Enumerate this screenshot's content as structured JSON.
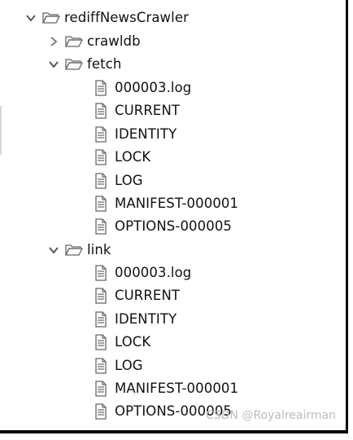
{
  "tree": {
    "root": {
      "label": "rediffNewsCrawler",
      "expanded": true,
      "icon": "folder-open-icon"
    },
    "crawldb": {
      "label": "crawldb",
      "expanded": false,
      "icon": "folder-open-icon"
    },
    "fetch": {
      "label": "fetch",
      "expanded": true,
      "icon": "folder-open-icon",
      "files": [
        "000003.log",
        "CURRENT",
        "IDENTITY",
        "LOCK",
        "LOG",
        "MANIFEST-000001",
        "OPTIONS-000005"
      ]
    },
    "link": {
      "label": "link",
      "expanded": true,
      "icon": "folder-open-icon",
      "files": [
        "000003.log",
        "CURRENT",
        "IDENTITY",
        "LOCK",
        "LOG",
        "MANIFEST-000001",
        "OPTIONS-000005"
      ]
    }
  },
  "watermark": "CSDN @Royalreairman",
  "colors": {
    "text": "#111111",
    "icon_stroke": "#666666",
    "chevron": "#555555",
    "watermark": "#bdbdbd"
  }
}
